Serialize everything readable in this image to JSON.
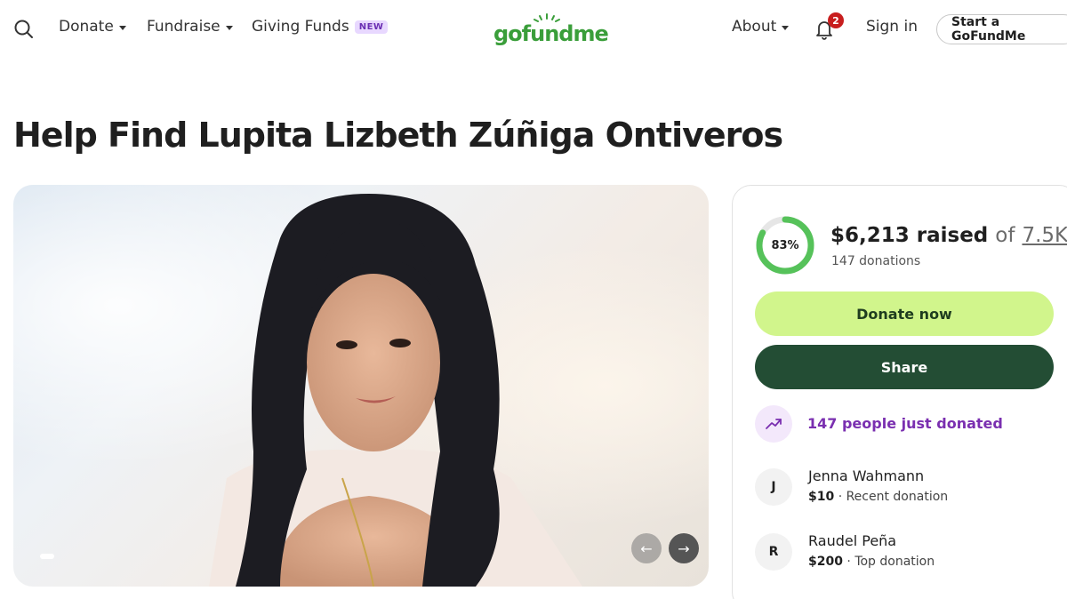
{
  "header": {
    "nav": {
      "donate": "Donate",
      "fundraise": "Fundraise",
      "giving_funds": "Giving Funds",
      "new_badge": "NEW",
      "about": "About"
    },
    "logo_text": "gofundme",
    "notification_count": "2",
    "sign_in": "Sign in",
    "start_button": "Start a GoFundMe"
  },
  "page_title": "Help Find Lupita Lizbeth Zúñiga Ontiveros",
  "hero": {
    "image_label": "Fundraiser photo",
    "prev_arrow": "←",
    "next_arrow": "→"
  },
  "donation_card": {
    "progress_percent": 83,
    "progress_label": "83%",
    "raised_amount": "$6,213 raised",
    "raised_of": "of",
    "goal": "7.5K",
    "donations_count": "147 donations",
    "donate_now": "Donate now",
    "share": "Share",
    "trend_text": "147 people just donated",
    "donors": [
      {
        "initial": "J",
        "name": "Jenna Wahmann",
        "amount": "$10",
        "label": "· Recent donation"
      },
      {
        "initial": "R",
        "name": "Raudel Peña",
        "amount": "$200",
        "label": "· Top donation"
      }
    ]
  },
  "colors": {
    "brand_green": "#3a9e3a",
    "donate_button": "#d1f58c",
    "share_button": "#234d34",
    "trend_purple": "#7a2fb0",
    "notification_red": "#c81e1e"
  }
}
